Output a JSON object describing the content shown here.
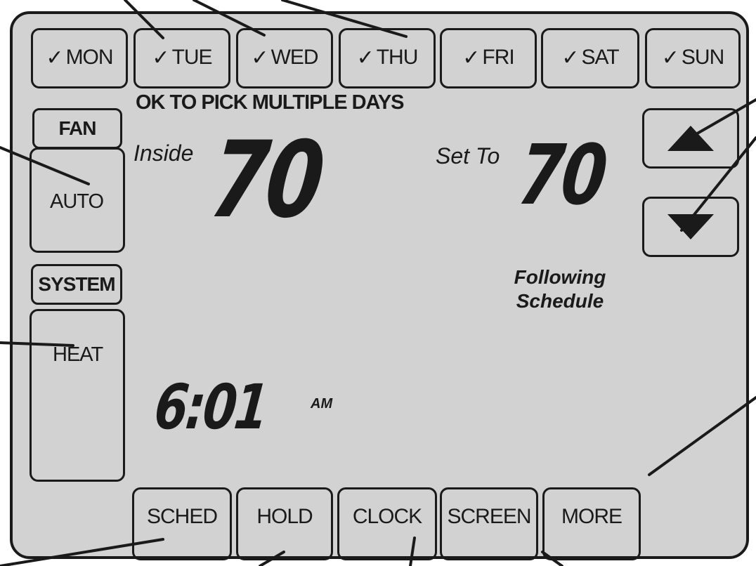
{
  "days": [
    {
      "check": "✓",
      "label": "MON"
    },
    {
      "check": "✓",
      "label": "TUE"
    },
    {
      "check": "✓",
      "label": "WED"
    },
    {
      "check": "✓",
      "label": "THU"
    },
    {
      "check": "✓",
      "label": "FRI"
    },
    {
      "check": "✓",
      "label": "SAT"
    },
    {
      "check": "✓",
      "label": "SUN"
    }
  ],
  "heading": "OK TO PICK MULTIPLE DAYS",
  "fan": {
    "label": "FAN",
    "mode": "AUTO"
  },
  "system": {
    "label": "SYSTEM",
    "mode": "HEAT"
  },
  "inside": {
    "label": "Inside",
    "value": "70"
  },
  "setpoint": {
    "label": "Set To",
    "value": "70"
  },
  "status": {
    "line1": "Following",
    "line2": "Schedule"
  },
  "clock": {
    "time": "6:01",
    "ampm": "AM"
  },
  "bottom_buttons": [
    "SCHED",
    "HOLD",
    "CLOCK",
    "SCREEN",
    "MORE"
  ],
  "icons": {
    "up": "up-triangle-icon",
    "down": "down-triangle-icon"
  },
  "colors": {
    "screen": "#d2d2d2",
    "ink": "#1a1a1a"
  }
}
